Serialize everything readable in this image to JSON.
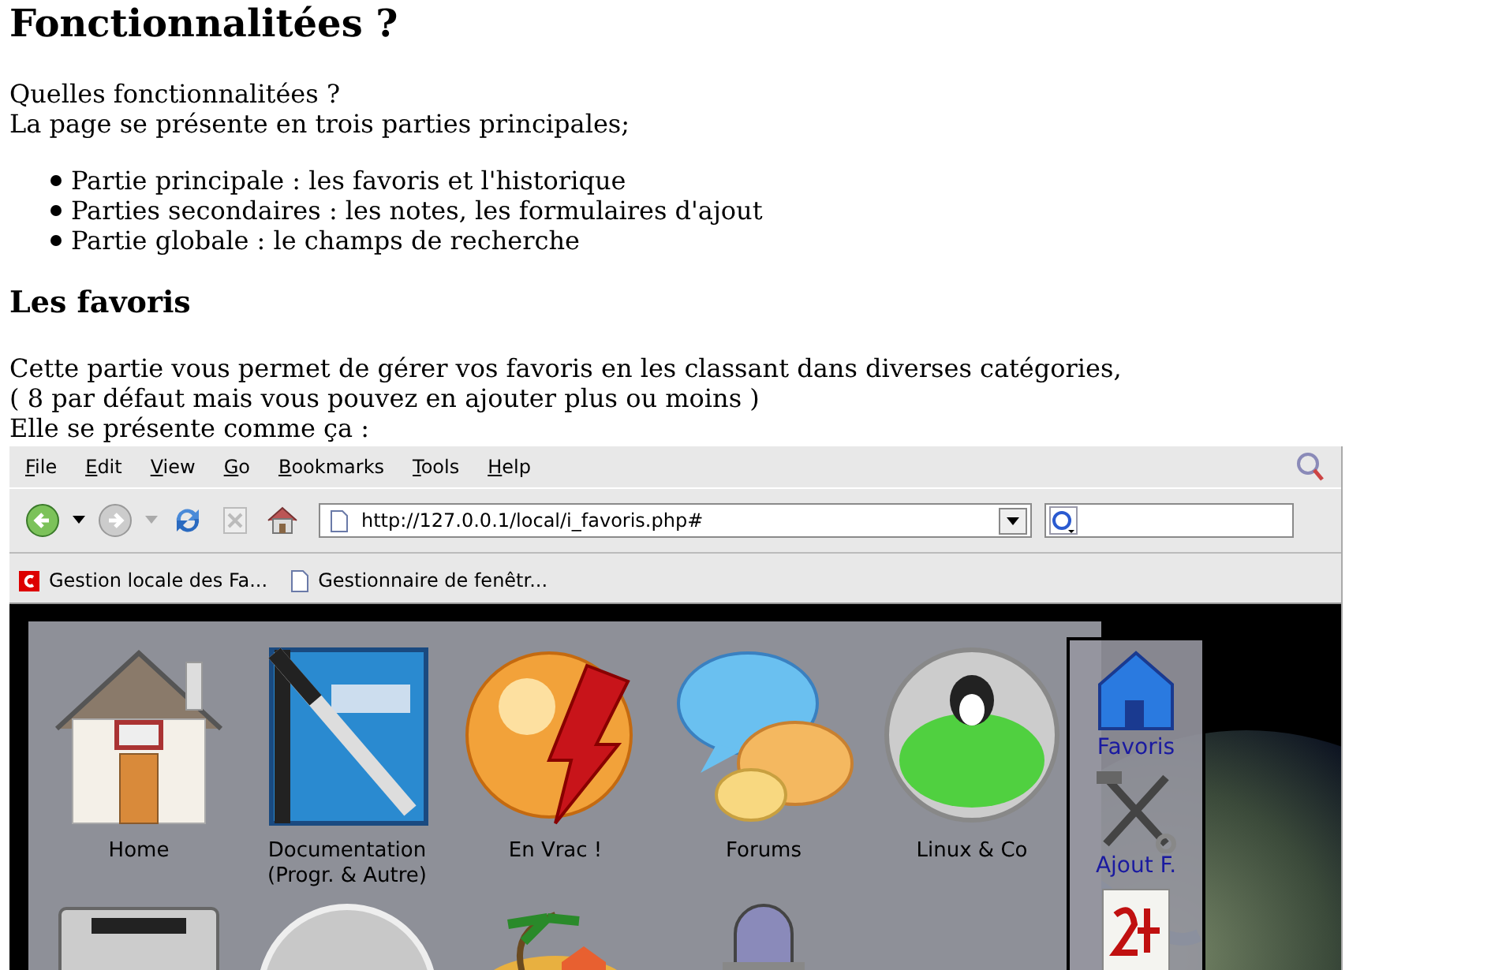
{
  "page": {
    "title": "Fonctionnalitées ?",
    "intro": [
      "Quelles fonctionnalitées ?",
      "La page se présente en trois parties principales;"
    ],
    "parts": [
      "Partie principale : les favoris et l'historique",
      "Parties secondaires : les notes, les formulaires d'ajout",
      "Partie globale : le champs de recherche"
    ],
    "section_title": "Les favoris",
    "section_text": [
      "Cette partie vous permet de gérer vos favoris en les classant dans diverses catégories,",
      "( 8 par défaut mais vous pouvez en ajouter plus ou moins )",
      "Elle se présente comme ça :"
    ]
  },
  "screenshot": {
    "menu": [
      "File",
      "Edit",
      "View",
      "Go",
      "Bookmarks",
      "Tools",
      "Help"
    ],
    "address": "http://127.0.0.1/local/i_favoris.php#",
    "bookmarks": [
      "Gestion locale des Fa...",
      "Gestionnaire de fenêtr..."
    ],
    "favorites": [
      {
        "label": "Home",
        "kind": "house"
      },
      {
        "label": "Documentation\n(Progr. & Autre)",
        "kind": "notebook"
      },
      {
        "label": "En Vrac !",
        "kind": "sphere-bolt"
      },
      {
        "label": "Forums",
        "kind": "bubbles"
      },
      {
        "label": "Linux & Co",
        "kind": "penguin"
      }
    ],
    "favorites_row_2": [
      {
        "kind": "drive"
      },
      {
        "kind": "sphere"
      },
      {
        "kind": "island"
      },
      {
        "kind": "microphone"
      }
    ],
    "sidebar": [
      {
        "label": "Favoris",
        "kind": "house"
      },
      {
        "label": "Ajout F.",
        "kind": "tools"
      },
      {
        "kind": "calendar"
      }
    ]
  }
}
